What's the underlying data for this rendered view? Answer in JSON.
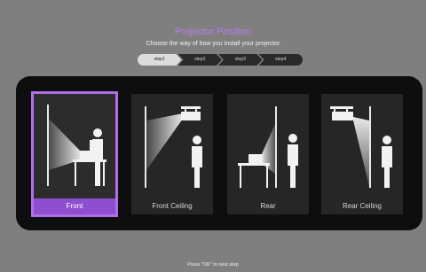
{
  "header": {
    "title": "Projector Position",
    "subtitle": "Choose the way of how you install your projector"
  },
  "steps": [
    {
      "label": "step1",
      "active": true
    },
    {
      "label": "step2",
      "active": false
    },
    {
      "label": "step3",
      "active": false
    },
    {
      "label": "step4",
      "active": false
    }
  ],
  "options": [
    {
      "label": "Front",
      "selected": true,
      "icon": "front-projection-icon"
    },
    {
      "label": "Front Ceiling",
      "selected": false,
      "icon": "front-ceiling-projection-icon"
    },
    {
      "label": "Rear",
      "selected": false,
      "icon": "rear-projection-icon"
    },
    {
      "label": "Rear Ceiling",
      "selected": false,
      "icon": "rear-ceiling-projection-icon"
    }
  ],
  "footer": {
    "hint": "Press \"OK\" to next step"
  },
  "colors": {
    "accent": "#b06de8",
    "selected_label_bg": "#8d4fd0",
    "background": "#7f7f7f",
    "panel": "#0e0e0e"
  }
}
